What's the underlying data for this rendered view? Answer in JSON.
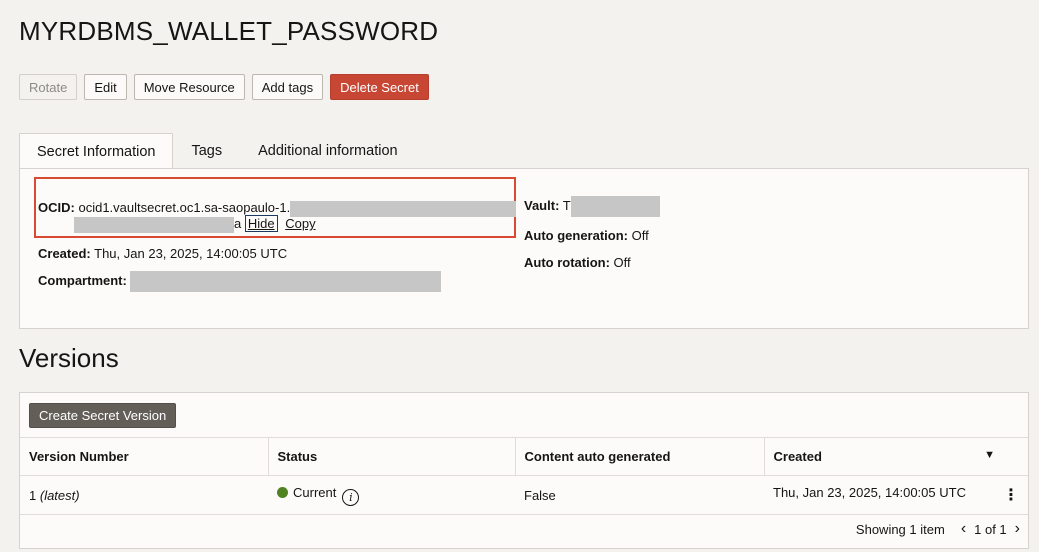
{
  "page": {
    "title": "MYRDBMS_WALLET_PASSWORD"
  },
  "toolbar": {
    "rotate": "Rotate",
    "edit": "Edit",
    "move": "Move Resource",
    "add_tags": "Add tags",
    "delete": "Delete Secret"
  },
  "tabs": [
    {
      "label": "Secret Information",
      "active": true
    },
    {
      "label": "Tags",
      "active": false
    },
    {
      "label": "Additional information",
      "active": false
    }
  ],
  "info": {
    "ocid_label": "OCID:",
    "ocid_value": "ocid1.vaultsecret.oc1.sa-saopaulo-1.",
    "ocid_tail": "a",
    "hide": "Hide",
    "copy": "Copy",
    "created_label": "Created:",
    "created_value": "Thu, Jan 23, 2025, 14:00:05 UTC",
    "compartment_label": "Compartment:",
    "compartment_value": "",
    "vault_label": "Vault:",
    "vault_value": "T",
    "autogen_label": "Auto generation:",
    "autogen_value": "Off",
    "autorot_label": "Auto rotation:",
    "autorot_value": "Off"
  },
  "versions": {
    "heading": "Versions",
    "create_button": "Create Secret Version",
    "columns": [
      "Version Number",
      "Status",
      "Content auto generated",
      "Created"
    ],
    "rows": [
      {
        "version": "1",
        "version_tag": "(latest)",
        "status": "Current",
        "auto_generated": "False",
        "created": "Thu, Jan 23, 2025, 14:00:05 UTC"
      }
    ],
    "showing": "Showing 1 item",
    "page": "1 of 1"
  },
  "colors": {
    "danger": "#c74634",
    "status_current": "#508223",
    "highlight": "#d94a33"
  }
}
